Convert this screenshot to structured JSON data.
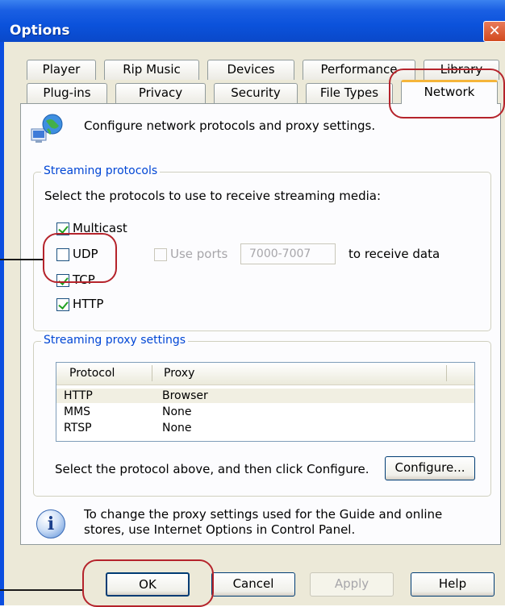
{
  "window": {
    "title": "Options"
  },
  "tabs_row1": [
    "Player",
    "Rip Music",
    "Devices",
    "Performance",
    "Library"
  ],
  "tabs_row2": [
    "Plug-ins",
    "Privacy",
    "Security",
    "File Types",
    "Network"
  ],
  "header": {
    "text": "Configure network protocols and proxy settings."
  },
  "streaming_protocols": {
    "legend": "Streaming protocols",
    "instruction": "Select the protocols to use to receive streaming media:",
    "multicast": {
      "label": "Multicast",
      "checked": true
    },
    "udp": {
      "label": "UDP",
      "checked": false
    },
    "use_ports": {
      "label": "Use ports",
      "checked": false
    },
    "ports_value": "7000-7007",
    "receive_label": "to receive data",
    "tcp": {
      "label": "TCP",
      "checked": true
    },
    "http": {
      "label": "HTTP",
      "checked": true
    }
  },
  "proxy": {
    "legend": "Streaming proxy settings",
    "columns": [
      "Protocol",
      "Proxy"
    ],
    "rows": [
      {
        "protocol": "HTTP",
        "proxy": "Browser"
      },
      {
        "protocol": "MMS",
        "proxy": "None"
      },
      {
        "protocol": "RTSP",
        "proxy": "None"
      }
    ],
    "hint": "Select the protocol above, and then click Configure.",
    "configure_label": "Configure..."
  },
  "info": {
    "line1": "To change the proxy settings used for the Guide and online",
    "line2": "stores, use Internet Options in Control Panel."
  },
  "buttons": {
    "ok": "OK",
    "cancel": "Cancel",
    "apply": "Apply",
    "help": "Help"
  },
  "colors": {
    "annotation": "#b5232b",
    "titlebar": "#0a4ee0",
    "accent_tab": "#f5b53a"
  }
}
